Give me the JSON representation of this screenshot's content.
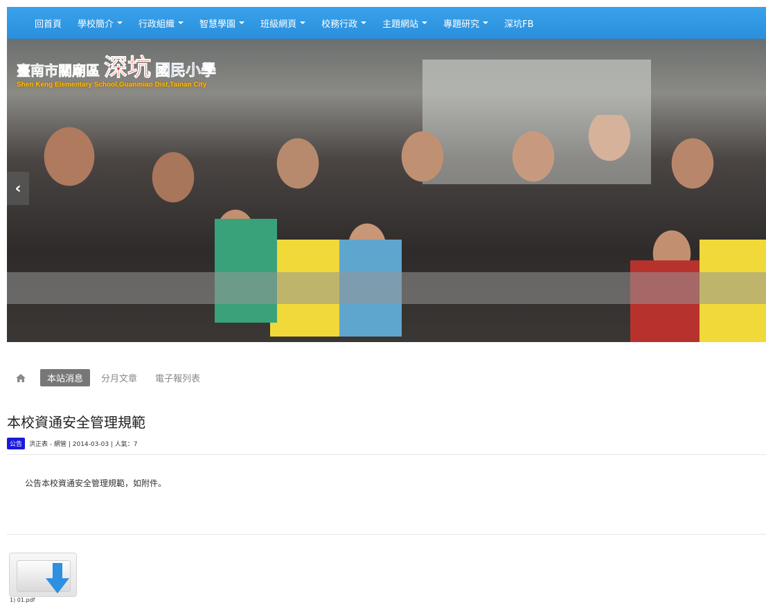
{
  "nav": {
    "items": [
      {
        "label": "回首頁",
        "dropdown": false
      },
      {
        "label": "學校簡介",
        "dropdown": true
      },
      {
        "label": "行政組織",
        "dropdown": true
      },
      {
        "label": "智慧學園",
        "dropdown": true
      },
      {
        "label": "班級網頁",
        "dropdown": true
      },
      {
        "label": "校務行政",
        "dropdown": true
      },
      {
        "label": "主題網站",
        "dropdown": true
      },
      {
        "label": "專題研究",
        "dropdown": true
      },
      {
        "label": "深坑FB",
        "dropdown": false
      }
    ],
    "bg_color": "#2e94e0"
  },
  "banner": {
    "logo": {
      "city": "臺南市關廟區",
      "name": "深坑",
      "school": "國民小學",
      "english": "Shen Keng Elementary School,Guanmiao Dist,Tainan City"
    },
    "prev_icon": "‹"
  },
  "tabs": {
    "home_icon": "home-icon",
    "items": [
      "本站消息",
      "分月文章",
      "電子報列表"
    ],
    "active": "本站消息"
  },
  "article": {
    "title": "本校資通安全管理規範",
    "badge": "公告",
    "meta": "洪正表 - 網管 | 2014-03-03 | 人氣：7",
    "body": "公告本校資通安全管理規範，如附件。"
  },
  "attachment": {
    "icon": "download-file-icon",
    "label": "1) 01.pdf"
  }
}
